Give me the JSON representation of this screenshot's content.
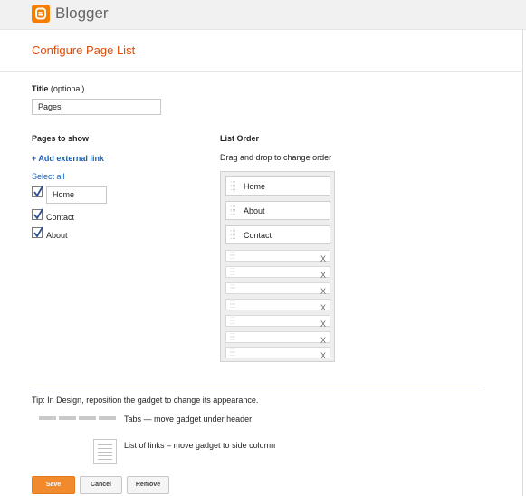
{
  "brand": {
    "name": "Blogger",
    "accent": "#f57d00"
  },
  "page_title": "Configure Page List",
  "title_field": {
    "label": "Title",
    "optional": "(optional)",
    "value": "Pages"
  },
  "pages_to_show": {
    "heading": "Pages to show",
    "add_external_link": "+ Add external link",
    "select_all": "Select all",
    "pages": [
      {
        "label": "Home",
        "checked": true
      },
      {
        "label": "Contact",
        "checked": true
      },
      {
        "label": "About",
        "checked": true
      }
    ]
  },
  "list_order": {
    "heading": "List Order",
    "hint": "Drag and drop to change order",
    "items": [
      "Home",
      "About",
      "Contact"
    ],
    "empty_slot_close": "X"
  },
  "tip": {
    "text": "Tip: In Design, reposition the gadget to change its appearance.",
    "tabs_desc": "Tabs — move gadget under header",
    "list_desc": "List of links – move gadget to side column"
  },
  "buttons": {
    "save": "Save",
    "cancel": "Cancel",
    "remove": "Remove"
  }
}
